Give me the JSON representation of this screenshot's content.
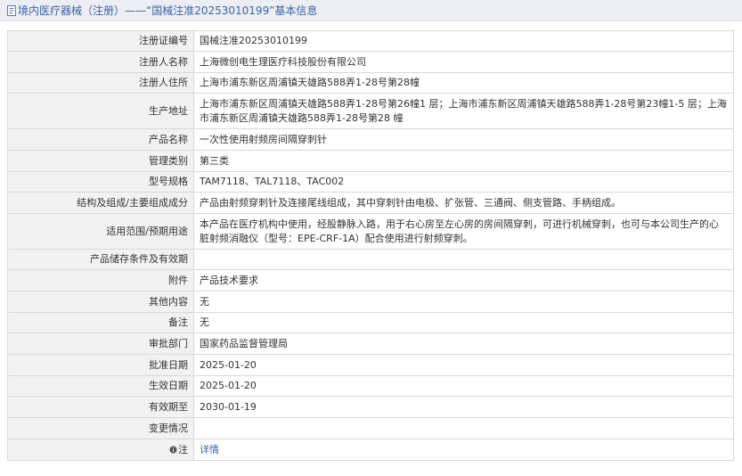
{
  "header": {
    "title": "境内医疗器械（注册）——“国械注准20253010199”基本信息"
  },
  "rows": [
    {
      "label": "注册证编号",
      "value": "国械注准20253010199"
    },
    {
      "label": "注册人名称",
      "value": "上海微创电生理医疗科技股份有限公司"
    },
    {
      "label": "注册人住所",
      "value": "上海市浦东新区周浦镇天雄路588弄1-28号第28幢"
    },
    {
      "label": "生产地址",
      "value": "上海市浦东新区周浦镇天雄路588弄1-28号第26幢1 层；上海市浦东新区周浦镇天雄路588弄1-28号第23幢1-5 层；上海市浦东新区周浦镇天雄路588弄1-28号第28 幢"
    },
    {
      "label": "产品名称",
      "value": "一次性使用射频房间隔穿刺针"
    },
    {
      "label": "管理类别",
      "value": "第三类"
    },
    {
      "label": "型号规格",
      "value": "TAM7118、TAL7118、TAC002"
    },
    {
      "label": "结构及组成/主要组成成分",
      "value": "产品由射频穿刺针及连接尾线组成，其中穿刺针由电极、扩张管、三通阀、侧支管路、手柄组成。"
    },
    {
      "label": "适用范围/预期用途",
      "value": "本产品在医疗机构中使用，经股静脉入路，用于右心房至左心房的房间隔穿刺，可进行机械穿刺，也可与本公司生产的心脏射频消融仪（型号：EPE-CRF-1A）配合使用进行射频穿刺。"
    },
    {
      "label": "产品储存条件及有效期",
      "value": ""
    },
    {
      "label": "附件",
      "value": "产品技术要求"
    },
    {
      "label": "其他内容",
      "value": "无"
    },
    {
      "label": "备注",
      "value": "无"
    },
    {
      "label": "审批部门",
      "value": "国家药品监督管理局"
    },
    {
      "label": "批准日期",
      "value": "2025-01-20"
    },
    {
      "label": "生效日期",
      "value": "2025-01-20"
    },
    {
      "label": "有效期至",
      "value": "2030-01-19"
    },
    {
      "label": "变更情况",
      "value": ""
    }
  ],
  "note_row": {
    "label": "注",
    "icon": "info-icon",
    "link_text": "详情"
  }
}
